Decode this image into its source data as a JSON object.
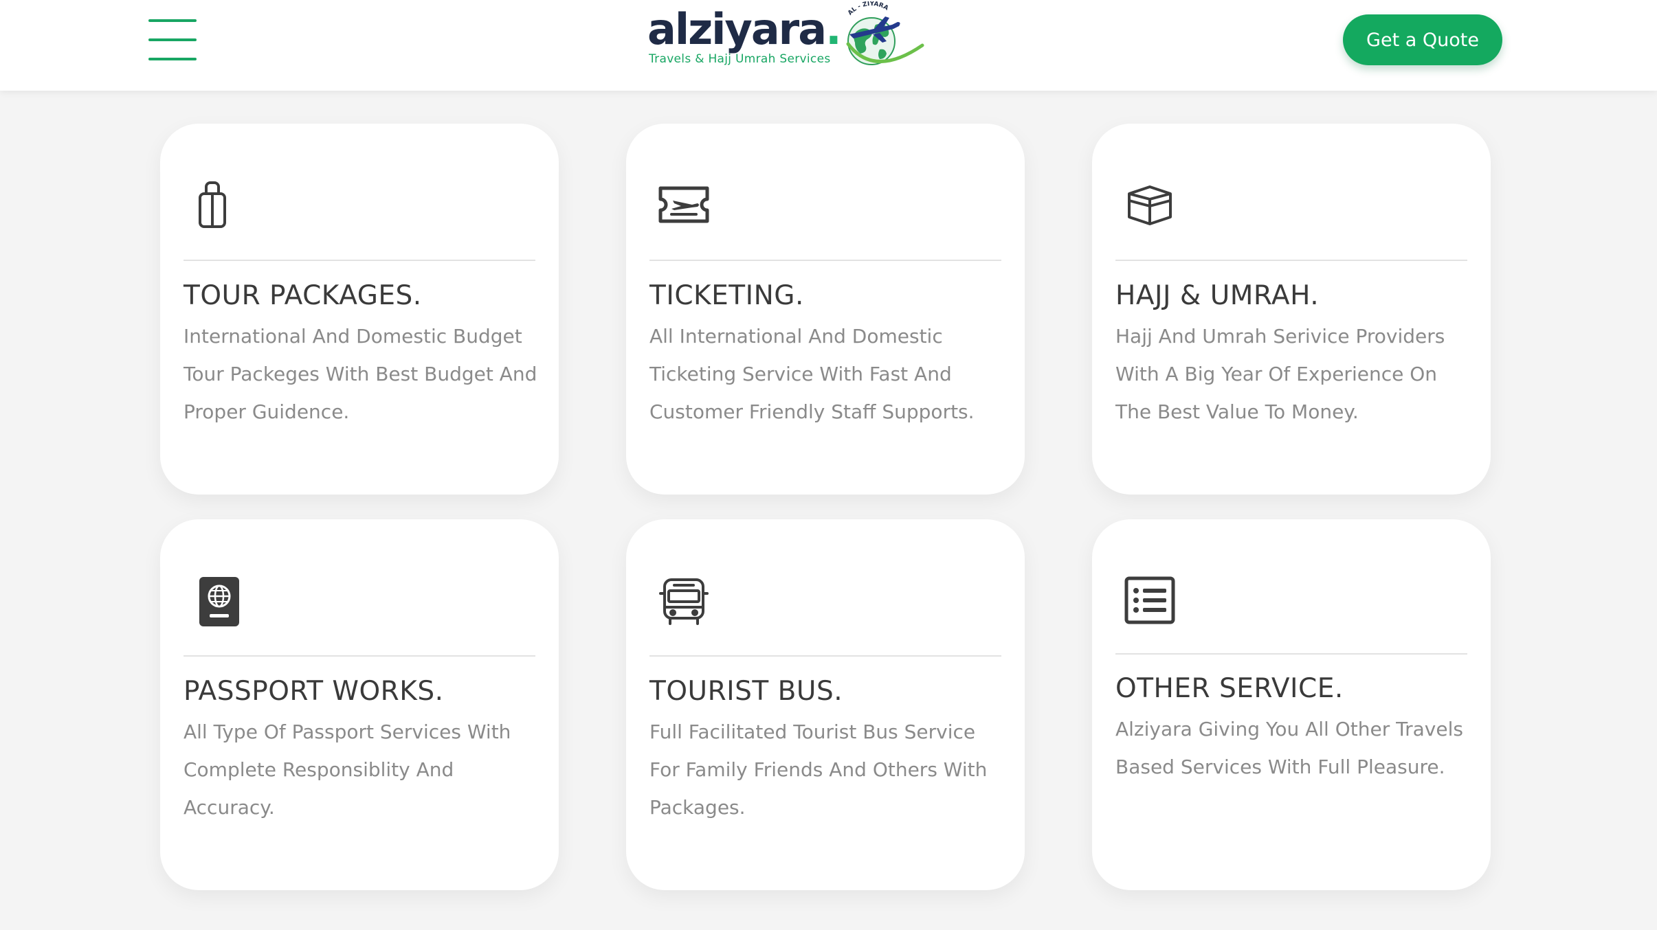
{
  "header": {
    "menu_icon": "hamburger-menu-icon",
    "logo": {
      "wordmark": "alziyara",
      "dot": ".",
      "tagline": "Travels & Hajj Umrah  Services",
      "emblem_text": "AL - ZIYARA"
    },
    "cta_label": "Get a Quote"
  },
  "colors": {
    "brand_green": "#14a95f",
    "logo_navy": "#1f2b46",
    "icon_dark": "#3d3d3d",
    "page_background": "#f4f4f4"
  },
  "services": [
    {
      "icon": "suitcase-icon",
      "title": "TOUR PACKAGES.",
      "description": "International And Domestic Budget Tour Packeges With Best Budget And Proper Guidence."
    },
    {
      "icon": "plane-ticket-icon",
      "title": "TICKETING.",
      "description": "All International And Domestic Ticketing Service With Fast And Customer Friendly Staff Supports."
    },
    {
      "icon": "kaaba-icon",
      "title": "HAJJ & UMRAH.",
      "description": "Hajj And Umrah Serivice Providers With A Big Year Of Experience On The Best Value To Money."
    },
    {
      "icon": "passport-icon",
      "title": "PASSPORT WORKS.",
      "description": "All Type Of Passport Services With Complete Responsiblity And Accuracy."
    },
    {
      "icon": "bus-icon",
      "title": "TOURIST BUS.",
      "description": "Full Facilitated Tourist Bus Service For Family Friends And Others With Packages."
    },
    {
      "icon": "list-icon",
      "title": "OTHER SERVICE.",
      "description": "Alziyara Giving You All Other Travels Based Services With Full Pleasure."
    }
  ]
}
